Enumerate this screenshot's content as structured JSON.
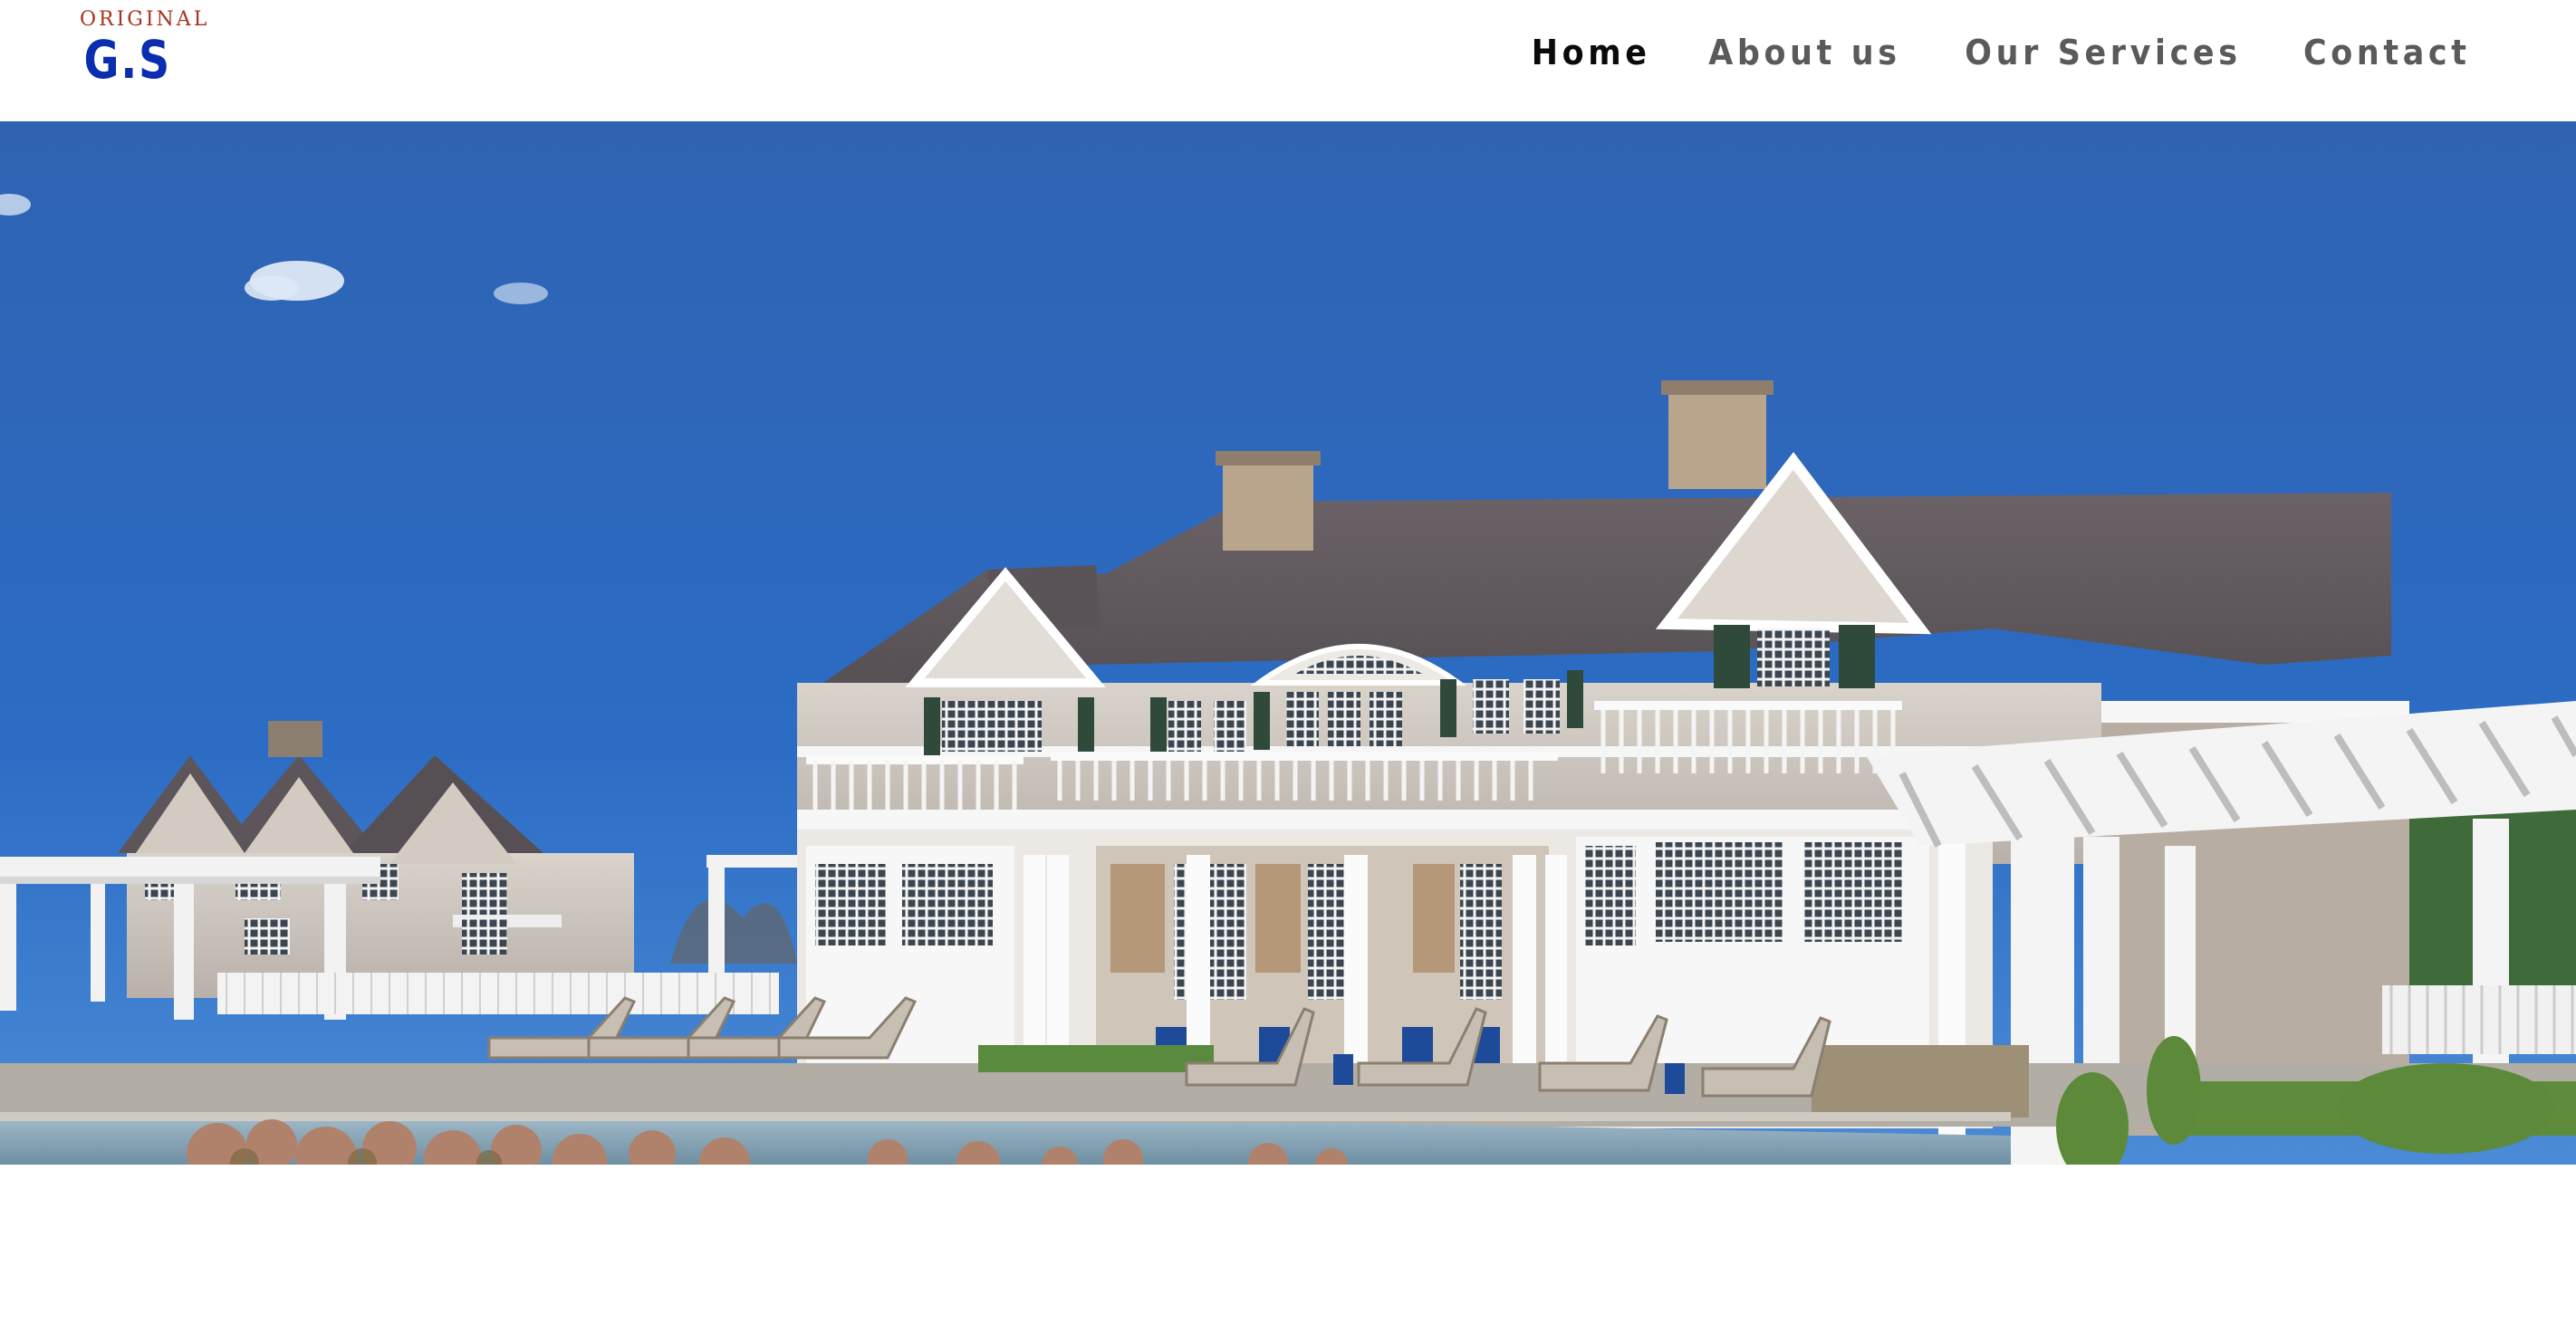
{
  "logo": {
    "small_text": "ORIGINAL",
    "big_text": "G.S"
  },
  "nav": {
    "items": [
      {
        "label": "Home",
        "active": true
      },
      {
        "label": "About us",
        "active": false
      },
      {
        "label": "Our Services",
        "active": false
      },
      {
        "label": "Contact",
        "active": false
      }
    ]
  },
  "colors": {
    "logo_small": "#a8321e",
    "logo_big": "#0b2db0",
    "nav_active": "#0a0a0a",
    "nav_inactive": "#5a5a5a",
    "sky": "#2a66b8"
  }
}
